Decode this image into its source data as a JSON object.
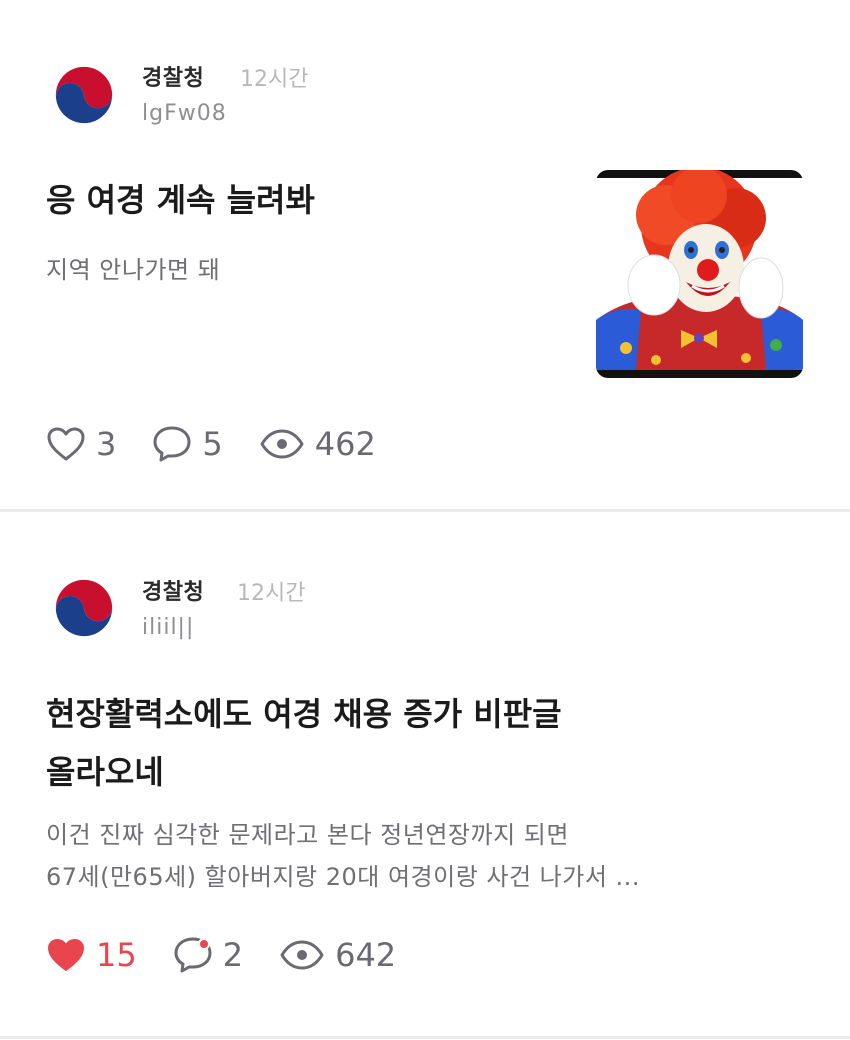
{
  "colors": {
    "accent_like": "#e8454f",
    "muted": "#6f6f74",
    "divider": "#ececef"
  },
  "posts": [
    {
      "author": "경찰청",
      "time": "12시간",
      "user_id": "lgFw08",
      "title": "응 여경 계속 늘려봐",
      "excerpt_lines": [
        "지역 안나가면 돼"
      ],
      "has_thumbnail": true,
      "liked": false,
      "likes": "3",
      "comments": "5",
      "views": "462"
    },
    {
      "author": "경찰청",
      "time": "12시간",
      "user_id": "iliil||",
      "title_lines": [
        "현장활력소에도 여경 채용 증가 비판글",
        "올라오네"
      ],
      "excerpt_lines": [
        "이건 진짜 심각한 문제라고 본다  정년연장까지 되면",
        "67세(만65세) 할아버지랑 20대 여경이랑 사건 나가서 ..."
      ],
      "has_thumbnail": false,
      "liked": true,
      "likes": "15",
      "comments": "2",
      "views": "642"
    }
  ]
}
